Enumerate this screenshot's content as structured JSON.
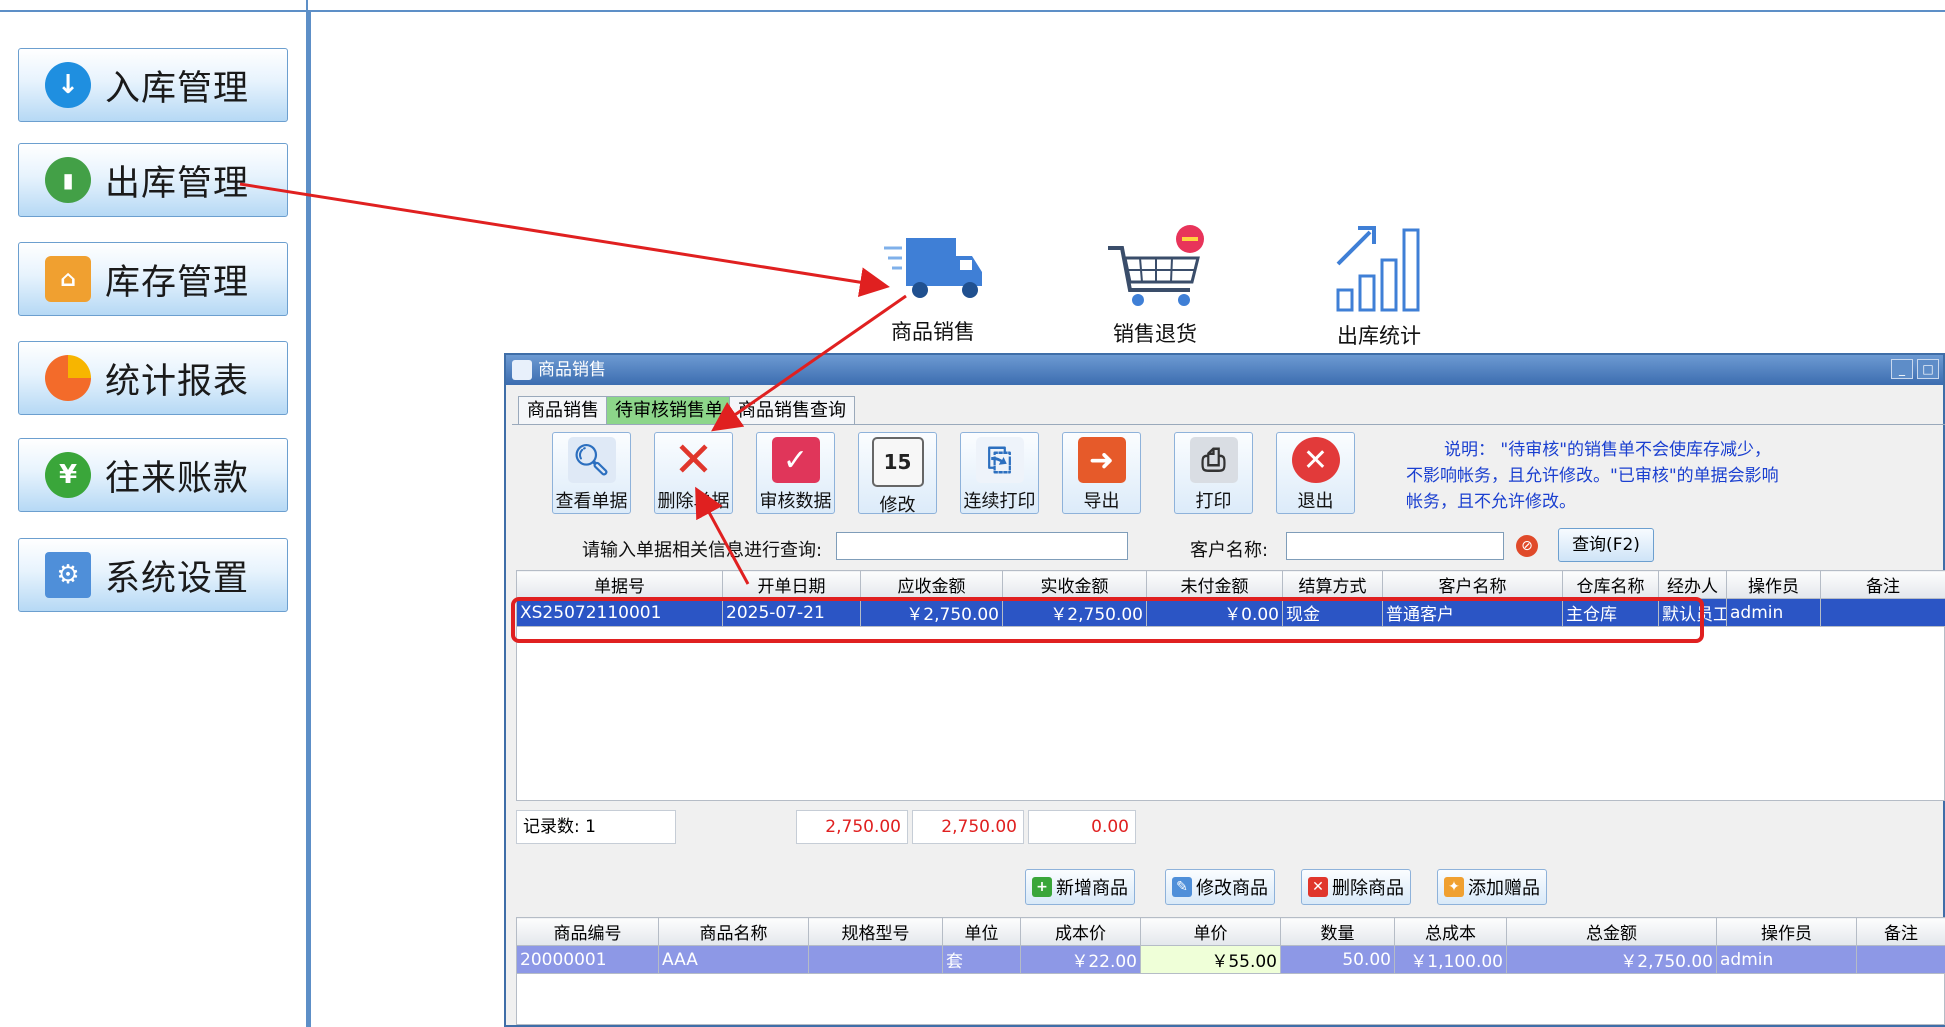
{
  "sidebar": {
    "items": [
      {
        "label": "入库管理",
        "icon": "arrow-down-icon",
        "color": "#1f8fe0"
      },
      {
        "label": "出库管理",
        "icon": "bar-chart-icon",
        "color": "#43a047"
      },
      {
        "label": "库存管理",
        "icon": "warehouse-icon",
        "color": "#f0a030"
      },
      {
        "label": "统计报表",
        "icon": "pie-chart-icon",
        "color": "#f36b2a"
      },
      {
        "label": "往来账款",
        "icon": "yen-icon",
        "color": "#3aa63a"
      },
      {
        "label": "系统设置",
        "icon": "gear-icon",
        "color": "#4f8fd9"
      }
    ]
  },
  "modules": {
    "sales": "商品销售",
    "return": "销售退货",
    "stats": "出库统计"
  },
  "window": {
    "title": "商品销售",
    "min": "_",
    "max": "□"
  },
  "tabs": [
    "商品销售",
    "待审核销售单",
    "商品销售查询"
  ],
  "toolbar": [
    {
      "label": "查看单据",
      "icon": "magnifier-icon"
    },
    {
      "label": "删除单据",
      "icon": "delete-x-icon"
    },
    {
      "label": "审核数据",
      "icon": "check-icon"
    },
    {
      "label": "修改",
      "icon": "calendar-edit-icon",
      "glyph": "15"
    },
    {
      "label": "连续打印",
      "icon": "scroll-icon"
    },
    {
      "label": "导出",
      "icon": "export-icon"
    },
    {
      "label": "打印",
      "icon": "printer-icon"
    },
    {
      "label": "退出",
      "icon": "exit-icon"
    }
  ],
  "note": {
    "line1": "说明：  \"待审核\"的销售单不会使库存减少，",
    "line2": "不影响帐务，且允许修改。\"已审核\"的单据会影响",
    "line3": "帐务，且不允许修改。"
  },
  "search": {
    "label": "请输入单据相关信息进行查询:",
    "customer_label": "客户名称:",
    "query_button": "查询(F2)"
  },
  "orders": {
    "columns": [
      "单据号",
      "开单日期",
      "应收金额",
      "实收金额",
      "未付金额",
      "结算方式",
      "客户名称",
      "仓库名称",
      "经办人",
      "操作员",
      "备注"
    ],
    "rows": [
      [
        "XS25072110001",
        "2025-07-21",
        "￥2,750.00",
        "￥2,750.00",
        "￥0.00",
        "现金",
        "普通客户",
        "主仓库",
        "默认员工",
        "admin",
        ""
      ]
    ]
  },
  "summary": {
    "record_count": "记录数: 1",
    "receivable": "2,750.00",
    "received": "2,750.00",
    "unpaid": "0.00"
  },
  "actions": [
    "新增商品",
    "修改商品",
    "删除商品",
    "添加赠品"
  ],
  "items": {
    "columns": [
      "商品编号",
      "商品名称",
      "规格型号",
      "单位",
      "成本价",
      "单价",
      "数量",
      "总成本",
      "总金额",
      "操作员",
      "备注"
    ],
    "rows": [
      [
        "20000001",
        "AAA",
        "",
        "套",
        "￥22.00",
        "￥55.00",
        "50.00",
        "￥1,100.00",
        "￥2,750.00",
        "admin",
        ""
      ]
    ]
  },
  "colors": {
    "frame": "#5d8fc7",
    "annotation": "#e02020",
    "selected_row": "#2b55c5",
    "active_tab": "#8dd68a"
  }
}
